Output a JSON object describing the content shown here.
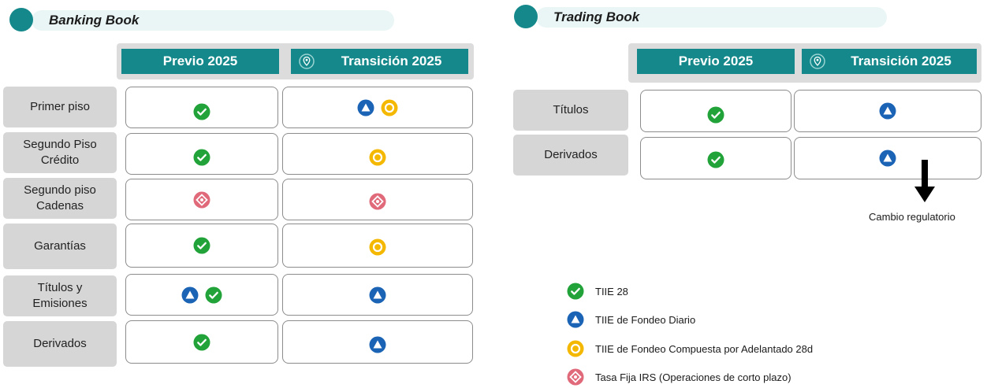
{
  "banking": {
    "title": "Banking Book",
    "col_previo": "Previo 2025",
    "col_transicion": "Transición 2025",
    "rows": [
      {
        "label": "Primer piso",
        "previo": [
          "tiie28"
        ],
        "transicion": [
          "fondeo_diario",
          "fondeo_compuesta"
        ]
      },
      {
        "label": "Segundo Piso\nCrédito",
        "previo": [
          "tiie28"
        ],
        "transicion": [
          "fondeo_compuesta"
        ]
      },
      {
        "label": "Segundo piso\nCadenas",
        "previo": [
          "tasa_fija"
        ],
        "transicion": [
          "tasa_fija"
        ]
      },
      {
        "label": "Garantías",
        "previo": [
          "tiie28"
        ],
        "transicion": [
          "fondeo_compuesta"
        ]
      },
      {
        "label": "Títulos y\nEmisiones",
        "previo": [
          "fondeo_diario",
          "tiie28"
        ],
        "transicion": [
          "fondeo_diario"
        ]
      },
      {
        "label": "Derivados",
        "previo": [
          "tiie28"
        ],
        "transicion": [
          "fondeo_diario"
        ]
      }
    ]
  },
  "trading": {
    "title": "Trading Book",
    "col_previo": "Previo 2025",
    "col_transicion": "Transición 2025",
    "rows": [
      {
        "label": "Títulos",
        "previo": [
          "tiie28"
        ],
        "transicion": [
          "fondeo_diario"
        ]
      },
      {
        "label": "Derivados",
        "previo": [
          "tiie28"
        ],
        "transicion": [
          "fondeo_diario"
        ]
      }
    ]
  },
  "annotation": "Cambio regulatorio",
  "legend": [
    {
      "key": "tiie28",
      "label": "TIIE 28"
    },
    {
      "key": "fondeo_diario",
      "label": "TIIE de Fondeo Diario"
    },
    {
      "key": "fondeo_compuesta",
      "label": "TIIE de Fondeo Compuesta por Adelantado 28d"
    },
    {
      "key": "tasa_fija",
      "label": "Tasa Fija IRS (Operaciones de corto plazo)"
    }
  ],
  "icons": {
    "tiie28": {
      "name": "green-check-icon",
      "color": "#22a33a"
    },
    "fondeo_diario": {
      "name": "blue-triangle-icon",
      "color": "#1b63b5"
    },
    "fondeo_compuesta": {
      "name": "yellow-circle-icon",
      "color": "#f5b800"
    },
    "tasa_fija": {
      "name": "pink-diamond-icon",
      "color": "#e0697a"
    }
  }
}
